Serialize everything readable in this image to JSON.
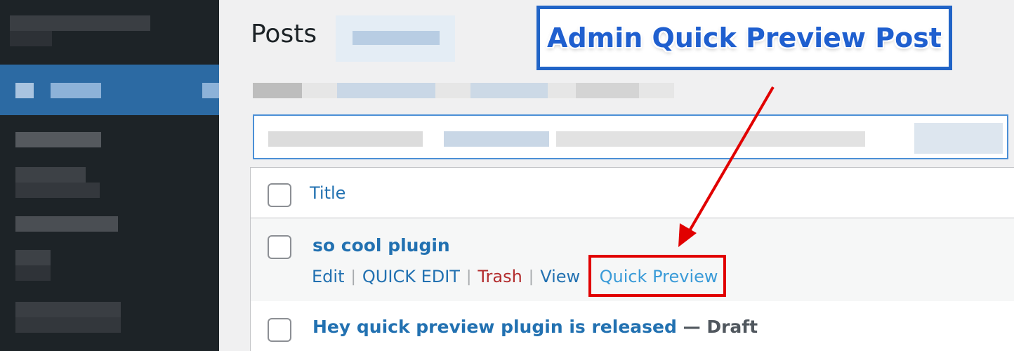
{
  "page": {
    "title": "Posts",
    "banner": "Admin Quick Preview Post"
  },
  "table": {
    "header": {
      "title_label": "Title"
    },
    "rows": [
      {
        "title": "so cool plugin",
        "actions": {
          "edit": "Edit",
          "quick_edit": "QUICK EDIT",
          "trash": "Trash",
          "view": "View",
          "quick_preview": "Quick Preview"
        }
      },
      {
        "title": "Hey quick preview plugin is released",
        "status": "— Draft"
      }
    ]
  },
  "colors": {
    "link": "#2271b1",
    "trash": "#b32d2e",
    "highlight_box": "#e10000",
    "banner_border": "#2164c7"
  }
}
